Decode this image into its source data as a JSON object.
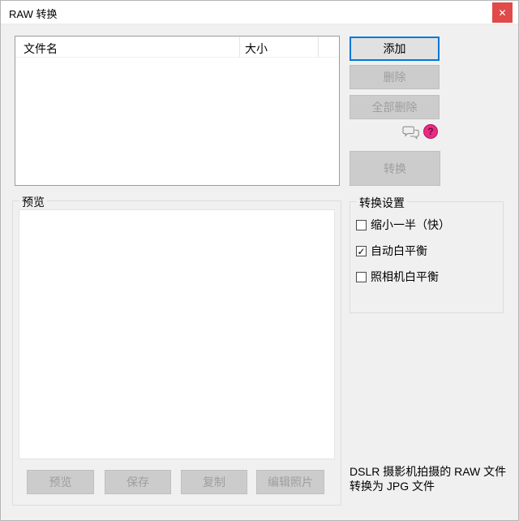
{
  "window": {
    "title": "RAW 转换",
    "close_glyph": "✕"
  },
  "file_list": {
    "columns": [
      {
        "label": "文件名"
      },
      {
        "label": "大小"
      }
    ],
    "rows": []
  },
  "action_buttons": {
    "add": {
      "label": "添加",
      "enabled": true
    },
    "delete": {
      "label": "删除",
      "enabled": false
    },
    "delete_all": {
      "label": "全部删除",
      "enabled": false
    },
    "convert": {
      "label": "转换",
      "enabled": false
    }
  },
  "toolbar_icons": {
    "chat": {
      "name": "speech-bubbles-icon"
    },
    "help": {
      "glyph": "?",
      "color": "#e82c83"
    }
  },
  "preview_group": {
    "title": "预览",
    "buttons": [
      {
        "label": "预览",
        "enabled": false
      },
      {
        "label": "保存",
        "enabled": false
      },
      {
        "label": "复制",
        "enabled": false
      },
      {
        "label": "编辑照片",
        "enabled": false
      }
    ]
  },
  "settings_group": {
    "title": "转换设置",
    "checkboxes": [
      {
        "label": "缩小一半（快）",
        "checked": false,
        "glyph": ""
      },
      {
        "label": "自动白平衡",
        "checked": true,
        "glyph": "✓"
      },
      {
        "label": "照相机白平衡",
        "checked": false,
        "glyph": ""
      }
    ]
  },
  "description": {
    "line1": "DSLR 摄影机拍摄的 RAW 文件",
    "line2": "转换为 JPG 文件"
  },
  "colors": {
    "accent_blue": "#0078d7",
    "close_red": "#e04a4a",
    "help_pink": "#e82c83",
    "dialog_bg": "#f0f0f0",
    "disabled_bg": "#cccccc",
    "disabled_text": "#9e9e9e",
    "titlebar_bg": "#ffffff"
  }
}
